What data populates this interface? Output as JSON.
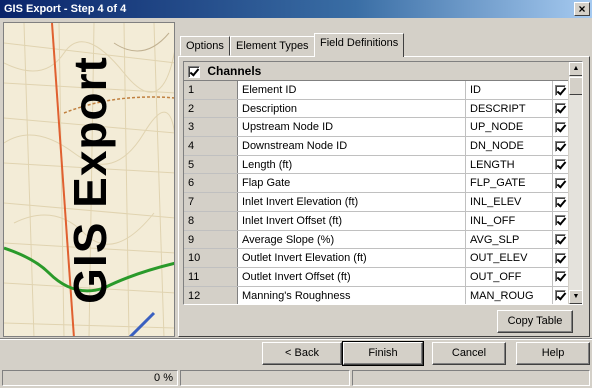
{
  "window": {
    "title": "GIS Export - Step 4 of 4",
    "close_glyph": "×"
  },
  "banner": {
    "text": "GIS Export"
  },
  "tabs": [
    {
      "label": "Options",
      "active": false
    },
    {
      "label": "Element Types",
      "active": false
    },
    {
      "label": "Field Definitions",
      "active": true
    }
  ],
  "grid": {
    "group_label": "Channels",
    "group_checked": true,
    "rows": [
      {
        "num": "1",
        "name": "Element ID",
        "field": "ID",
        "checked": true
      },
      {
        "num": "2",
        "name": "Description",
        "field": "DESCRIPT",
        "checked": true
      },
      {
        "num": "3",
        "name": "Upstream Node ID",
        "field": "UP_NODE",
        "checked": true
      },
      {
        "num": "4",
        "name": "Downstream Node ID",
        "field": "DN_NODE",
        "checked": true
      },
      {
        "num": "5",
        "name": "Length (ft)",
        "field": "LENGTH",
        "checked": true
      },
      {
        "num": "6",
        "name": "Flap Gate",
        "field": "FLP_GATE",
        "checked": true
      },
      {
        "num": "7",
        "name": "Inlet Invert Elevation (ft)",
        "field": "INL_ELEV",
        "checked": true
      },
      {
        "num": "8",
        "name": "Inlet Invert Offset (ft)",
        "field": "INL_OFF",
        "checked": true
      },
      {
        "num": "9",
        "name": "Average Slope (%)",
        "field": "AVG_SLP",
        "checked": true
      },
      {
        "num": "10",
        "name": "Outlet Invert Elevation (ft)",
        "field": "OUT_ELEV",
        "checked": true
      },
      {
        "num": "11",
        "name": "Outlet Invert Offset (ft)",
        "field": "OUT_OFF",
        "checked": true
      },
      {
        "num": "12",
        "name": "Manning's Roughness",
        "field": "MAN_ROUG",
        "checked": true
      }
    ]
  },
  "buttons": {
    "copy_table": "Copy Table",
    "back": "< Back",
    "finish": "Finish",
    "cancel": "Cancel",
    "help": "Help"
  },
  "status": {
    "progress_text": "0 %",
    "progress_value": 0
  }
}
